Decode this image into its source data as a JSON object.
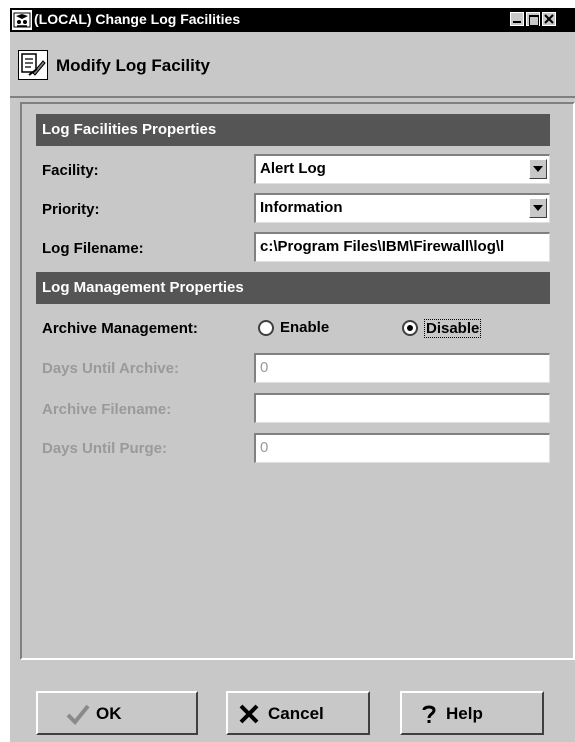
{
  "window": {
    "title": "(LOCAL) Change Log Facilities"
  },
  "header": {
    "title": "Modify Log Facility"
  },
  "log_facilities": {
    "section_title": "Log Facilities Properties",
    "facility_label": "Facility:",
    "facility_value": "Alert Log",
    "priority_label": "Priority:",
    "priority_value": "Information",
    "filename_label": "Log Filename:",
    "filename_value": "c:\\Program Files\\IBM\\Firewall\\log\\l"
  },
  "log_management": {
    "section_title": "Log Management Properties",
    "archive_label": "Archive Management:",
    "enable_label": "Enable",
    "disable_label": "Disable",
    "selected": "Disable",
    "days_archive_label": "Days Until Archive:",
    "days_archive_value": "0",
    "archive_filename_label": "Archive Filename:",
    "archive_filename_value": "",
    "days_purge_label": "Days Until Purge:",
    "days_purge_value": "0"
  },
  "buttons": {
    "ok": "OK",
    "cancel": "Cancel",
    "help": "Help"
  },
  "colors": {
    "titlebar": "#000000",
    "window_bg": "#c8c8c8",
    "section_bar": "#555555",
    "disabled_text": "#9a9a9a"
  },
  "icons": {
    "app": "app-icon",
    "header": "log-facility-icon",
    "ok": "check-icon",
    "cancel": "x-icon",
    "help": "question-icon",
    "dropdown": "chevron-down-icon"
  }
}
